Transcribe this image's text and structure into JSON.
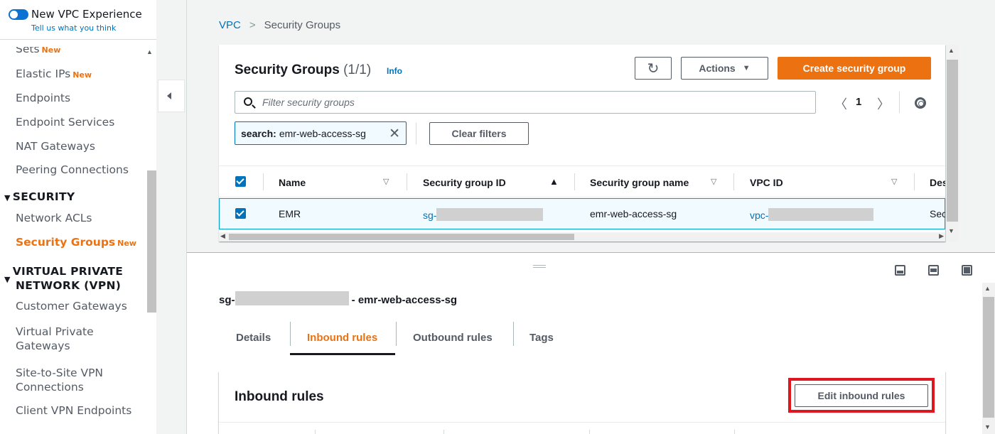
{
  "sidebar": {
    "toggle": {
      "title": "New VPC Experience",
      "feedback": "Tell us what you think"
    },
    "items_top": [
      {
        "label": "Sets",
        "badge": "New"
      },
      {
        "label": "Elastic IPs",
        "badge": "New"
      },
      {
        "label": "Endpoints",
        "badge": ""
      },
      {
        "label": "Endpoint Services",
        "badge": ""
      },
      {
        "label": "NAT Gateways",
        "badge": ""
      },
      {
        "label": "Peering Connections",
        "badge": ""
      }
    ],
    "security_section": "SECURITY",
    "security_items": [
      {
        "label": "Network ACLs",
        "badge": ""
      },
      {
        "label": "Security Groups",
        "badge": "New",
        "active": true
      }
    ],
    "vpn_section_line1": "VIRTUAL PRIVATE",
    "vpn_section_line2": "NETWORK (VPN)",
    "vpn_items": [
      {
        "label": "Customer Gateways"
      },
      {
        "label_line1": "Virtual Private",
        "label_line2": "Gateways"
      },
      {
        "label_line1": "Site-to-Site VPN",
        "label_line2": "Connections"
      },
      {
        "label": "Client VPN Endpoints"
      }
    ]
  },
  "breadcrumb": {
    "root": "VPC",
    "separator": ">",
    "current": "Security Groups"
  },
  "security_groups": {
    "title": "Security Groups",
    "count": "(1/1)",
    "info": "Info",
    "actions_label": "Actions",
    "create_label": "Create security group",
    "filter_placeholder": "Filter security groups",
    "page": "1",
    "token_key": "search:",
    "token_value": "emr-web-access-sg",
    "clear_filters_label": "Clear filters",
    "columns": [
      "Name",
      "Security group ID",
      "Security group name",
      "VPC ID",
      "Des"
    ],
    "row": {
      "name": "EMR",
      "sg_id_prefix": "sg-",
      "sg_name": "emr-web-access-sg",
      "vpc_id_prefix": "vpc-",
      "description": "Sec"
    }
  },
  "detail": {
    "title_prefix": "sg-",
    "title_suffix": "- emr-web-access-sg",
    "tabs": [
      "Details",
      "Inbound rules",
      "Outbound rules",
      "Tags"
    ],
    "active_tab": "Inbound rules",
    "inbound_title": "Inbound rules",
    "edit_inbound_label": "Edit inbound rules"
  },
  "colors": {
    "accent_orange": "#ec7211",
    "link_blue": "#0073bb",
    "highlight_red": "#e0161f",
    "selected_row_bg": "#f1faff"
  }
}
